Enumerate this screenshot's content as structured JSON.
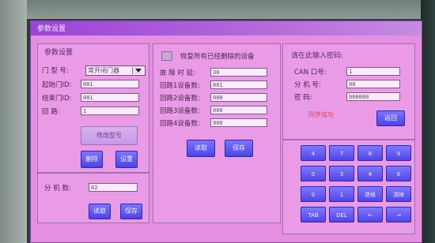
{
  "window": {
    "title": "参数设置"
  },
  "params": {
    "title": "参数设置",
    "door_type_label": "门 型 号:",
    "door_type_value": "常开闭门器",
    "start_id_label": "起始门ID:",
    "start_id_value": "001",
    "end_id_label": "结束门ID:",
    "end_id_value": "001",
    "loop_label": "回    路:",
    "loop_value": "1",
    "modify_model_label": "修改型号",
    "delete_label": "删除",
    "setup_label": "设置"
  },
  "extension": {
    "count_label": "分 机 数:",
    "count_value": "02",
    "read_label": "读取",
    "save_label": "保存"
  },
  "devices": {
    "restore_label": "恢复所有已经删除的设备",
    "fault_delay_label": "故 障 时 延:",
    "fault_delay_value": "30",
    "loop1_label": "回路1设备数:",
    "loop1_value": "001",
    "loop2_label": "回路2设备数:",
    "loop2_value": "000",
    "loop3_label": "回路3设备数:",
    "loop3_value": "000",
    "loop4_label": "回路4设备数:",
    "loop4_value": "000",
    "read_label": "读取",
    "save_label": "保存"
  },
  "password": {
    "title": "请在此输入密码:",
    "can_label": "CAN 口号:",
    "can_value": "1",
    "ext_label": "分 机 号:",
    "ext_value": "00",
    "pwd_label": "密    码:",
    "pwd_value": "000000",
    "status": "同步成功",
    "back_label": "返回"
  },
  "keypad": {
    "keys": [
      "4",
      "7",
      "8",
      "9",
      "0",
      "3",
      "4",
      "6",
      "0",
      "1",
      "退格",
      "清除",
      "TAB",
      "DEL",
      "←",
      "→"
    ]
  },
  "colors": {
    "screen_bg": "#e58fe0",
    "titlebar": "#9a44d8",
    "button": "#4a43e8",
    "status": "#d84b62"
  }
}
